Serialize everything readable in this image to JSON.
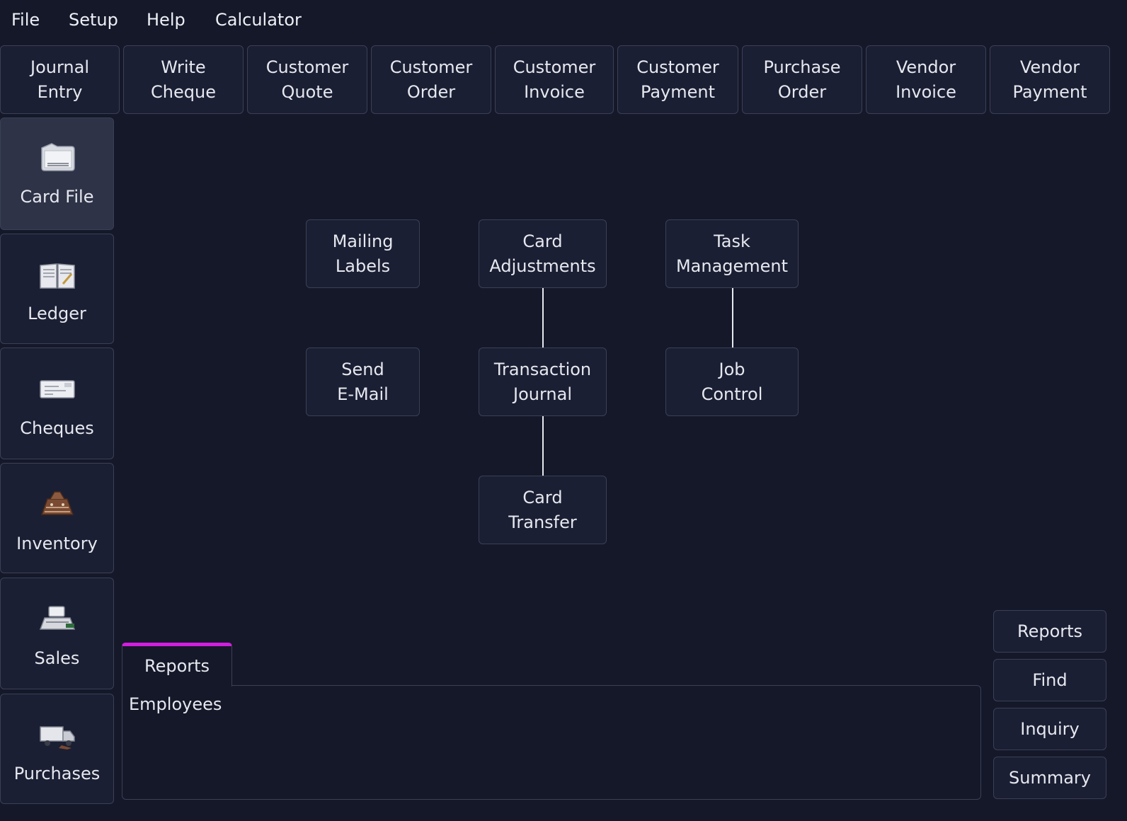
{
  "menubar": {
    "items": [
      "File",
      "Setup",
      "Help",
      "Calculator"
    ]
  },
  "toolbar": {
    "buttons": [
      "Journal\nEntry",
      "Write\nCheque",
      "Customer\nQuote",
      "Customer\nOrder",
      "Customer\nInvoice",
      "Customer\nPayment",
      "Purchase\nOrder",
      "Vendor\nInvoice",
      "Vendor\nPayment"
    ]
  },
  "sidebar": {
    "active": "Card File",
    "items": [
      {
        "label": "Card File",
        "icon": "folder-icon"
      },
      {
        "label": "Ledger",
        "icon": "ledger-book-icon"
      },
      {
        "label": "Cheques",
        "icon": "cheque-icon"
      },
      {
        "label": "Inventory",
        "icon": "inventory-icon"
      },
      {
        "label": "Sales",
        "icon": "cash-register-icon"
      },
      {
        "label": "Purchases",
        "icon": "delivery-truck-icon"
      }
    ]
  },
  "flowchart": {
    "mailing_labels": "Mailing\nLabels",
    "card_adjustments": "Card\nAdjustments",
    "task_management": "Task\nManagement",
    "send_email": "Send\nE-Mail",
    "transaction_journal": "Transaction\nJournal",
    "job_control": "Job\nControl",
    "card_transfer": "Card\nTransfer"
  },
  "tabs": {
    "active_tab": "Reports",
    "accent_color": "#d21ee0",
    "items": [
      "Employees"
    ]
  },
  "right_panel": {
    "buttons": [
      "Reports",
      "Find",
      "Inquiry",
      "Summary"
    ]
  }
}
